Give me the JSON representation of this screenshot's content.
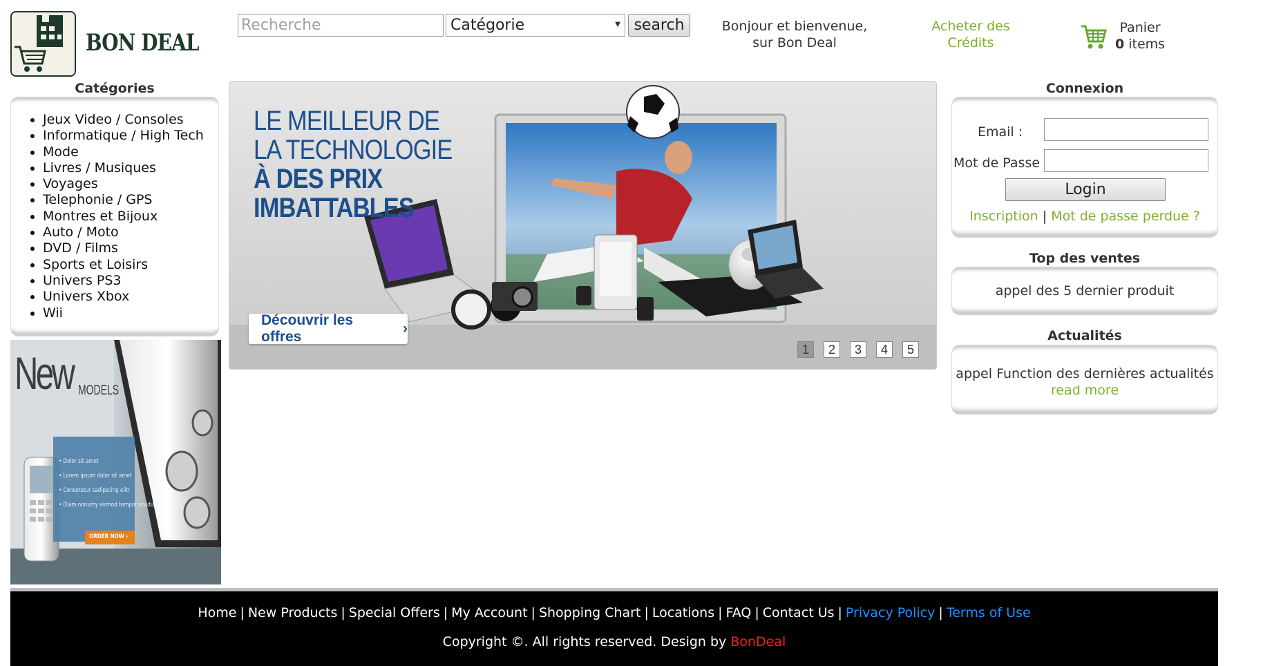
{
  "header": {
    "logo_text": "BON DEAL",
    "search_placeholder": "Recherche",
    "category_selected": "Catégorie",
    "search_button": "search",
    "welcome_line1": "Bonjour et bienvenue,",
    "welcome_line2": "sur Bon Deal",
    "credits_line1": "Acheter des",
    "credits_line2": "Crédits",
    "cart_label": "Panier",
    "cart_count": "0",
    "cart_items_suffix": "items"
  },
  "categories": {
    "title": "Catégories",
    "items": [
      "Jeux Video / Consoles",
      "Informatique / High Tech",
      "Mode",
      "Livres / Musiques",
      "Voyages",
      "Telephonie / GPS",
      "Montres et Bijoux",
      "Auto / Moto",
      "DVD / Films",
      "Sports et Loisirs",
      "Univers PS3",
      "Univers Xbox",
      "Wii"
    ]
  },
  "side_banner": {
    "headline": "New",
    "subline": "MODELS",
    "bullets": [
      "Dolor sit amet",
      "Lorem ipsum dolor sit amet",
      "Consetetur sadipscing elitr",
      "Diam nonumy eirmod tempor invidunt"
    ],
    "cta": "ORDER NOW ›"
  },
  "hero": {
    "line1": "LE MEILLEUR DE",
    "line2": "LA TECHNOLOGIE",
    "line3": "À DES PRIX",
    "line4": "IMBATTABLES",
    "cta": "Découvrir les offres",
    "cta_arrow": "›",
    "pages": [
      "1",
      "2",
      "3",
      "4",
      "5"
    ],
    "active_page": "1"
  },
  "login": {
    "title": "Connexion",
    "email_label": "Email :",
    "password_label": "Mot de Passe :",
    "button": "Login",
    "register_link": "Inscription",
    "separator": "|",
    "lost_password_link": "Mot de passe perdue ?"
  },
  "top_sales": {
    "title": "Top des ventes",
    "text": "appel des 5 dernier produit"
  },
  "news": {
    "title": "Actualités",
    "text": "appel Function des dernières actualités",
    "read_more": "read more"
  },
  "footer": {
    "links": [
      "Home",
      "New Products",
      "Special Offers",
      "My Account",
      "Shopping Chart",
      "Locations",
      "FAQ",
      "Contact Us",
      "Privacy Policy",
      "Terms of Use"
    ],
    "copyright_prefix": "Copyright ©. All rights reserved. Design by ",
    "copyright_brand": "BonDeal"
  },
  "colors": {
    "accent_green": "#7fb02a",
    "headline_blue": "#1c4f8c",
    "footer_link_blue": "#1e90ff",
    "brand_red": "#ff1a1a",
    "logo_dark": "#1e3a2a"
  }
}
